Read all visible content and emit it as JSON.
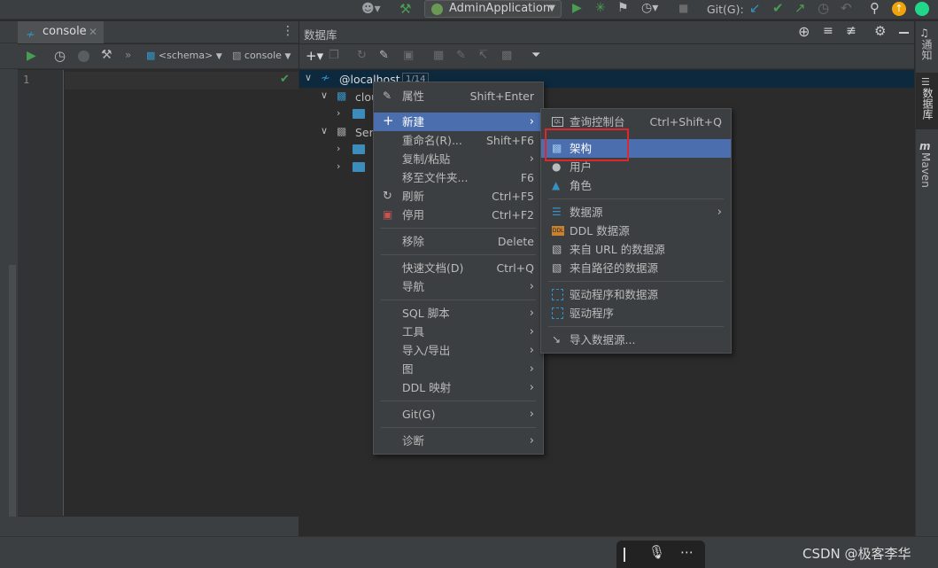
{
  "toolbar": {
    "run_config": "AdminApplication",
    "git_label": "Git(G):"
  },
  "editor": {
    "tab_label": "console",
    "schema_selector": "<schema>",
    "session_selector": "console",
    "line_numbers": [
      "1"
    ]
  },
  "db_panel": {
    "title": "数据库",
    "tree": [
      {
        "label": "@localhost",
        "badge": "1/14"
      },
      {
        "label": "clou"
      },
      {
        "label": "Ser"
      }
    ]
  },
  "right_strip": {
    "notifications": "通知",
    "database": "数据库",
    "maven": "Maven"
  },
  "context_menu": {
    "items": [
      {
        "label": "属性",
        "shortcut": "Shift+Enter"
      },
      {
        "label": "新建"
      },
      {
        "label": "重命名(R)...",
        "shortcut": "Shift+F6"
      },
      {
        "label": "复制/粘贴"
      },
      {
        "label": "移至文件夹...",
        "shortcut": "F6"
      },
      {
        "label": "刷新",
        "shortcut": "Ctrl+F5"
      },
      {
        "label": "停用",
        "shortcut": "Ctrl+F2"
      },
      {
        "label": "移除",
        "shortcut": "Delete"
      },
      {
        "label": "快速文档(D)",
        "shortcut": "Ctrl+Q"
      },
      {
        "label": "导航"
      },
      {
        "label": "SQL 脚本"
      },
      {
        "label": "工具"
      },
      {
        "label": "导入/导出"
      },
      {
        "label": "图"
      },
      {
        "label": "DDL 映射"
      },
      {
        "label": "Git(G)"
      },
      {
        "label": "诊断"
      }
    ]
  },
  "submenu": {
    "items": [
      {
        "label": "查询控制台",
        "shortcut": "Ctrl+Shift+Q"
      },
      {
        "label": "架构"
      },
      {
        "label": "用户"
      },
      {
        "label": "角色"
      },
      {
        "label": "数据源"
      },
      {
        "label": "DDL 数据源"
      },
      {
        "label": "来自 URL 的数据源"
      },
      {
        "label": "来自路径的数据源"
      },
      {
        "label": "驱动程序和数据源"
      },
      {
        "label": "驱动程序"
      },
      {
        "label": "导入数据源..."
      }
    ]
  },
  "watermark": "CSDN @极客李华",
  "colors": {
    "selection": "#4b6eaf",
    "highlight_box": "#e0262d",
    "run_green": "#499c54"
  }
}
